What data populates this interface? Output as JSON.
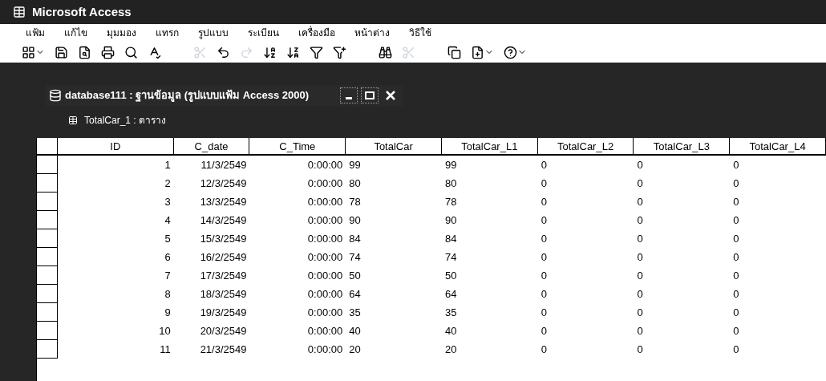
{
  "window": {
    "title": "Microsoft Access"
  },
  "menu": [
    "แฟ้ม",
    "แก้ไข",
    "มุมมอง",
    "แทรก",
    "รูปแบบ",
    "ระเบียน",
    "เครื่องมือ",
    "หน้าต่าง",
    "วิธีใช้"
  ],
  "toolbar_groups": [
    [
      {
        "kind": "view",
        "caret": true,
        "disabled": false
      },
      {
        "kind": "save",
        "caret": false,
        "disabled": false
      },
      {
        "kind": "search-file",
        "caret": false,
        "disabled": false
      },
      {
        "kind": "print",
        "caret": false,
        "disabled": false
      },
      {
        "kind": "preview",
        "caret": false,
        "disabled": false
      },
      {
        "kind": "spelling",
        "caret": false,
        "disabled": false
      }
    ],
    [
      {
        "kind": "cut",
        "caret": false,
        "disabled": true
      },
      {
        "kind": "undo",
        "caret": false,
        "disabled": false
      },
      {
        "kind": "redo",
        "caret": false,
        "disabled": true
      },
      {
        "kind": "sort-asc",
        "caret": false,
        "disabled": false
      },
      {
        "kind": "sort-desc",
        "caret": false,
        "disabled": false
      },
      {
        "kind": "filter",
        "caret": false,
        "disabled": false
      },
      {
        "kind": "filter-apply",
        "caret": false,
        "disabled": false
      }
    ],
    [
      {
        "kind": "find",
        "caret": false,
        "disabled": false
      },
      {
        "kind": "cut",
        "caret": false,
        "disabled": true
      }
    ],
    [
      {
        "kind": "windows",
        "caret": false,
        "disabled": false
      },
      {
        "kind": "new-object",
        "caret": true,
        "disabled": false
      },
      {
        "kind": "help",
        "caret": true,
        "disabled": false
      }
    ]
  ],
  "database_window": {
    "title": "database111 : ฐานข้อมูล (รูปแบบแฟ้ม Access 2000)"
  },
  "table_window": {
    "title": "TotalCar_1 : ตาราง"
  },
  "table": {
    "columns": [
      "ID",
      "C_date",
      "C_Time",
      "TotalCar",
      "TotalCar_L1",
      "TotalCar_L2",
      "TotalCar_L3",
      "TotalCar_L4"
    ],
    "rows": [
      [
        "1",
        "11/3/2549",
        "0:00:00",
        "99",
        "99",
        "0",
        "0",
        "0"
      ],
      [
        "2",
        "12/3/2549",
        "0:00:00",
        "80",
        "80",
        "0",
        "0",
        "0"
      ],
      [
        "3",
        "13/3/2549",
        "0:00:00",
        "78",
        "78",
        "0",
        "0",
        "0"
      ],
      [
        "4",
        "14/3/2549",
        "0:00:00",
        "90",
        "90",
        "0",
        "0",
        "0"
      ],
      [
        "5",
        "15/3/2549",
        "0:00:00",
        "84",
        "84",
        "0",
        "0",
        "0"
      ],
      [
        "6",
        "16/2/2549",
        "0:00:00",
        "74",
        "74",
        "0",
        "0",
        "0"
      ],
      [
        "7",
        "17/3/2549",
        "0:00:00",
        "50",
        "50",
        "0",
        "0",
        "0"
      ],
      [
        "8",
        "18/3/2549",
        "0:00:00",
        "64",
        "64",
        "0",
        "0",
        "0"
      ],
      [
        "9",
        "19/3/2549",
        "0:00:00",
        "35",
        "35",
        "0",
        "0",
        "0"
      ],
      [
        "10",
        "20/3/2549",
        "0:00:00",
        "40",
        "40",
        "0",
        "0",
        "0"
      ],
      [
        "11",
        "21/3/2549",
        "0:00:00",
        "20",
        "20",
        "0",
        "0",
        "0"
      ]
    ]
  }
}
